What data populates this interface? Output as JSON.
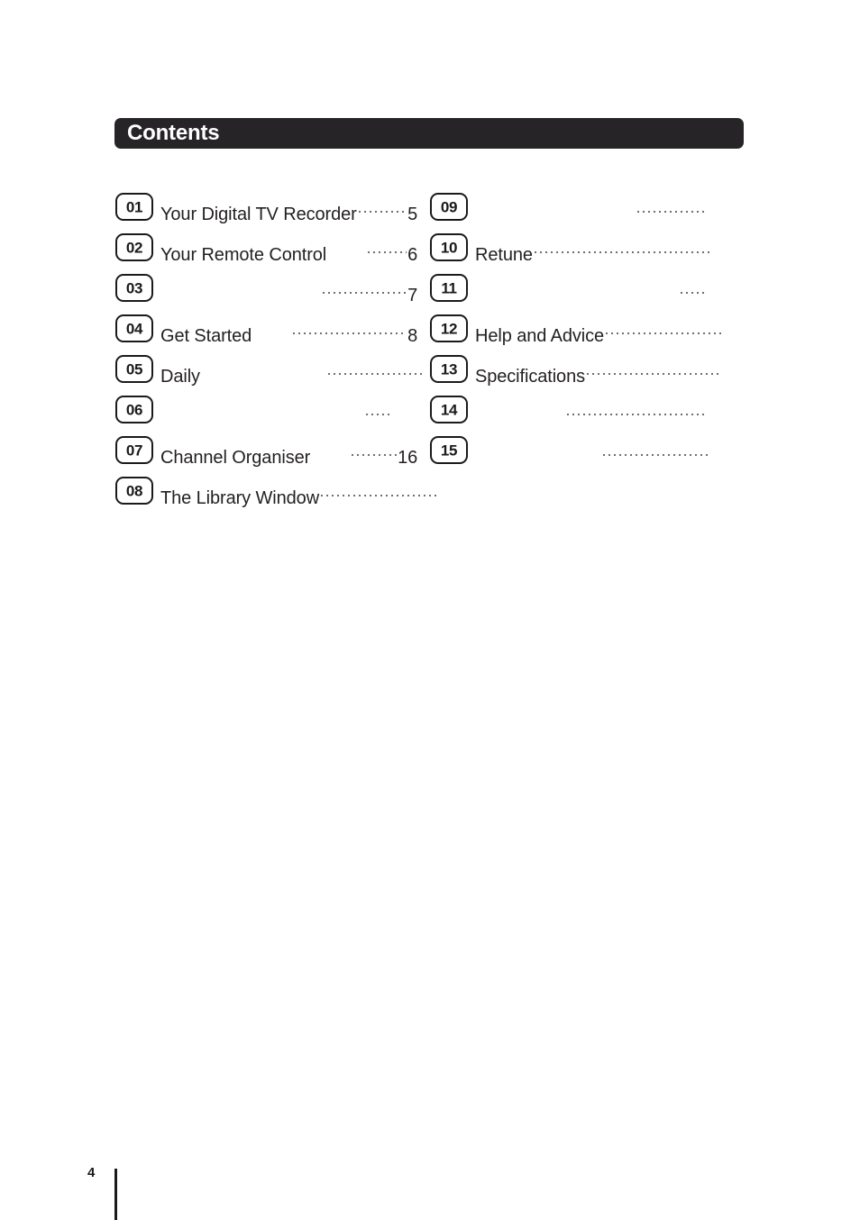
{
  "header": {
    "title": "Contents",
    "bar_color": "#262426",
    "title_color": "#ffffff"
  },
  "toc": {
    "left_column": [
      {
        "number": "01",
        "label": "Your Digital TV Recorder",
        "page": "5",
        "leader": "full"
      },
      {
        "number": "02",
        "label": "Your Remote Control",
        "page": "6",
        "leader": "full"
      },
      {
        "number": "03",
        "label": "",
        "page": "7",
        "leader": "inset-xl"
      },
      {
        "number": "04",
        "label": "Get Started",
        "page": "8",
        "leader": "full"
      },
      {
        "number": "05",
        "label": "Daily",
        "page": "",
        "leader": "inset-sm"
      },
      {
        "number": "06",
        "label": "",
        "page": "",
        "leader": "tiny"
      },
      {
        "number": "07",
        "label": "Channel Organiser",
        "page": "16",
        "leader": "full"
      },
      {
        "number": "08",
        "label": "The Library Window",
        "page": "",
        "leader": "full"
      }
    ],
    "right_column": [
      {
        "number": "09",
        "label": "",
        "page": "",
        "leader": "inset-lg"
      },
      {
        "number": "10",
        "label": "Retune",
        "page": "",
        "leader": "full"
      },
      {
        "number": "11",
        "label": "",
        "page": "",
        "leader": "tiny"
      },
      {
        "number": "12",
        "label": "Help and Advice",
        "page": "",
        "leader": "full"
      },
      {
        "number": "13",
        "label": "Specifications",
        "page": "",
        "leader": "full"
      },
      {
        "number": "14",
        "label": "",
        "page": "",
        "leader": "inset-md"
      },
      {
        "number": "15",
        "label": "",
        "page": "",
        "leader": "inset-lg"
      }
    ]
  },
  "footer": {
    "page_number": "4"
  }
}
